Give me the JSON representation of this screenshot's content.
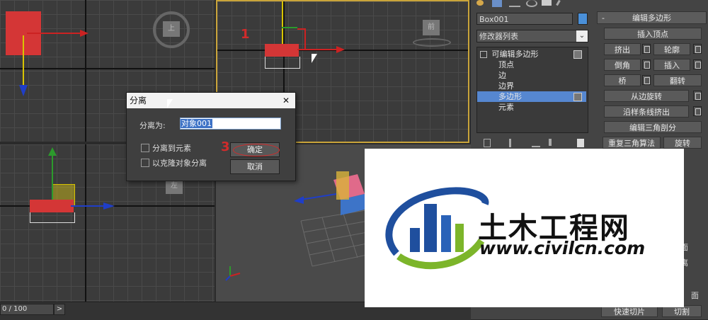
{
  "viewports": {
    "top_label": "上",
    "front_label": "前",
    "left_label": "左"
  },
  "annotations": {
    "step1": "1",
    "step3": "3"
  },
  "timeline": {
    "frame_counter": "0 / 100",
    "arrow": ">"
  },
  "command_panel": {
    "tab_icons": [
      "create-icon",
      "modify-icon",
      "hierarchy-icon",
      "motion-icon",
      "display-icon",
      "utilities-icon"
    ],
    "object_name": "Box001",
    "object_color": "#4a90d9",
    "modifier_list_label": "修改器列表",
    "stack": {
      "root": "可编辑多边形",
      "items": [
        "顶点",
        "边",
        "边界",
        "多边形",
        "元素"
      ],
      "selected": "多边形"
    },
    "rollout_title": "编辑多边形",
    "rollout_collapse": "-",
    "buttons": {
      "insert_vertex": "插入顶点",
      "extrude": "挤出",
      "outline": "轮廓",
      "bevel": "倒角",
      "inset": "插入",
      "bridge": "桥",
      "flip": "翻转",
      "hinge_from_edge": "从边旋转",
      "extrude_along_spline": "沿样条线挤出",
      "edit_triangulation": "编辑三角剖分",
      "retriangulate": "重复三角算法",
      "turn": "旋转",
      "partial_a": "面",
      "partial_b": "离",
      "partial_c": "面",
      "quickslice": "快速切片",
      "cut": "切割"
    }
  },
  "dialog": {
    "title": "分离",
    "close": "✕",
    "name_label": "分离为:",
    "name_value": "对象001",
    "detach_to_element": "分离到元素",
    "detach_as_clone": "以克隆对象分离",
    "ok": "确定",
    "cancel": "取消"
  },
  "logo": {
    "name": "土木工程网",
    "url": "www.civilcn.com",
    "colors": {
      "blue": "#1f4f9e",
      "green": "#7cb52a",
      "text": "#111111"
    }
  }
}
